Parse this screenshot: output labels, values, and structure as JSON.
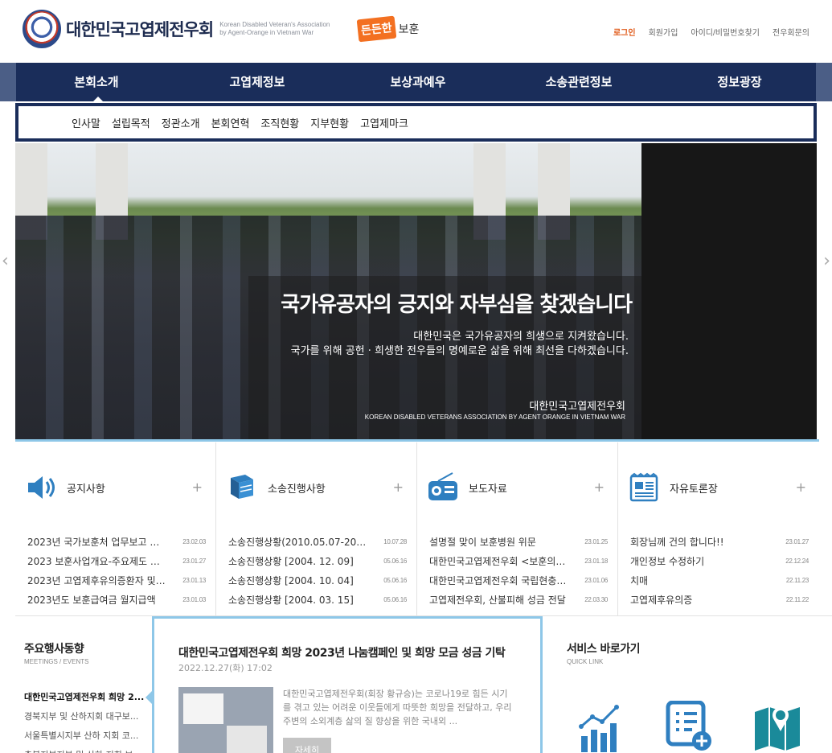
{
  "header": {
    "logo_title": "대한민국고엽제전우회",
    "logo_sub_line1": "Korean Disabled Veteran's Association",
    "logo_sub_line2": "by Agent-Orange in Vietnam War",
    "slogan_box": "든든한",
    "slogan_text": "보훈",
    "util": {
      "login": "로그인",
      "join": "회원가입",
      "find": "아이디/비밀번호찾기",
      "inquiry": "전우회문의"
    }
  },
  "gnb": {
    "items": [
      {
        "label": "본회소개"
      },
      {
        "label": "고엽제정보"
      },
      {
        "label": "보상과예우"
      },
      {
        "label": "소송관련정보"
      },
      {
        "label": "정보광장"
      }
    ]
  },
  "subnav": {
    "items": [
      {
        "label": "인사말"
      },
      {
        "label": "설립목적"
      },
      {
        "label": "정관소개"
      },
      {
        "label": "본회연혁"
      },
      {
        "label": "조직현황"
      },
      {
        "label": "지부현황"
      },
      {
        "label": "고엽제마크"
      }
    ]
  },
  "hero": {
    "title": "국가유공자의 긍지와 자부심을 찾겠습니다",
    "desc_line1": "대한민국은 국가유공자의  희생으로 지켜왔습니다.",
    "desc_line2": "국가를 위해 공헌 · 희생한 전우들의 명예로운 삶을 위해 최선을 다하겠습니다.",
    "sign": "대한민국고엽제전우회",
    "sign_en": "KOREAN DISABLED VETERANS ASSOCIATION BY AGENT ORANGE IN VIETNAM WAR"
  },
  "boards": [
    {
      "title": "공지사항",
      "icon": "speaker-icon",
      "items": [
        {
          "title": "2023년 국가보훈처 업무보고 안내",
          "date": "23.02.03"
        },
        {
          "title": "2023 보훈사업개요-주요제도 변경 ...",
          "date": "23.01.27"
        },
        {
          "title": "2023년 고엽제후유의증환자 및 2...",
          "date": "23.01.13"
        },
        {
          "title": "2023년도 보훈급여금 월지급액",
          "date": "23.01.03"
        }
      ]
    },
    {
      "title": "소송진행사항",
      "icon": "book-icon",
      "items": [
        {
          "title": "소송진행상황(2010.05.07-2010.07....",
          "date": "10.07.28"
        },
        {
          "title": "소송진행상황 [2004. 12. 09]",
          "date": "05.06.16"
        },
        {
          "title": "소송진행상황 [2004. 10. 04]",
          "date": "05.06.16"
        },
        {
          "title": "소송진행상황 [2004. 03. 15]",
          "date": "05.06.16"
        }
      ]
    },
    {
      "title": "보도자료",
      "icon": "radio-icon",
      "items": [
        {
          "title": "설명절 맞이 보훈병원 위문",
          "date": "23.01.25"
        },
        {
          "title": "대한민국고엽제전우회 <보훈의 집...",
          "date": "23.01.18"
        },
        {
          "title": "대한민국고엽제전우회 국립현충원 ...",
          "date": "23.01.06"
        },
        {
          "title": "고엽제전우회, 산불피해 성금 전달",
          "date": "22.03.30"
        }
      ]
    },
    {
      "title": "자유토론장",
      "icon": "newspaper-icon",
      "items": [
        {
          "title": "회장님께 건의 합니다!!",
          "date": "23.01.27"
        },
        {
          "title": "개인정보 수정하기",
          "date": "22.12.24"
        },
        {
          "title": "치매",
          "date": "22.11.23"
        },
        {
          "title": "고엽제후유의증",
          "date": "22.11.22"
        }
      ]
    }
  ],
  "events": {
    "title": "주요행사동향",
    "sub": "MEETINGS / EVENTS",
    "items": [
      {
        "label": "대한민국고엽제전우회 희망 2..."
      },
      {
        "label": "경북지부 및 산하지회 대구보..."
      },
      {
        "label": "서울특별시지부 산하 지회 코..."
      },
      {
        "label": "충북지부지부 및 산하 지회 보..."
      }
    ]
  },
  "feature": {
    "title": "대한민국고엽제전우회 희망 2023년 나눔캠페인 및 희망 모금 성금 기탁",
    "date": "2022.12.27(화) 17:02",
    "text": "대한민국고엽제전우회(회장 황규승)는 코로나19로 힘든 시기를 겪고 있는 어려운 이웃들에게 따뜻한 희망을 전달하고, 우리 주변의 소외계층 삶의 질 향상을 위한 국내외 ...",
    "more": "자세히"
  },
  "quick": {
    "title": "서비스 바로가기",
    "sub": "QUICK LINK",
    "icons": [
      "chart-icon",
      "document-add-icon",
      "map-pin-icon"
    ]
  },
  "colors": {
    "navy": "#1a2d5a",
    "accent_blue": "#8ec7e8",
    "orange": "#f37021",
    "icon_blue": "#2f7fc0",
    "icon_teal": "#1a8a9a"
  }
}
